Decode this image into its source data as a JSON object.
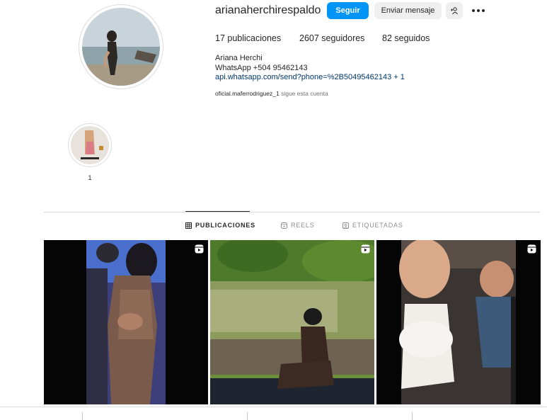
{
  "profile": {
    "username": "arianaherchirespaldo",
    "follow_label": "Seguir",
    "message_label": "Enviar mensaje",
    "stats": {
      "posts": "17 publicaciones",
      "followers": "2607 seguidores",
      "following": "82 seguidos"
    },
    "bio": {
      "name": "Ariana Herchi",
      "line1": "WhatsApp +504 95462143",
      "link": "api.whatsapp.com/send?phone=%2B50495462143 + 1"
    },
    "followed_by": {
      "account": "oficial.maferrodriguez_1",
      "suffix": " sigue esta cuenta"
    }
  },
  "highlights": [
    {
      "label": "1"
    }
  ],
  "tabs": [
    {
      "label": "PUBLICACIONES",
      "icon": "grid-icon",
      "active": true
    },
    {
      "label": "REELS",
      "icon": "reels-icon",
      "active": false
    },
    {
      "label": "ETIQUETADAS",
      "icon": "tagged-icon",
      "active": false
    }
  ],
  "colors": {
    "accent": "#0095f6",
    "link": "#00376b",
    "muted": "#737373",
    "divider": "#dbdbdb"
  }
}
